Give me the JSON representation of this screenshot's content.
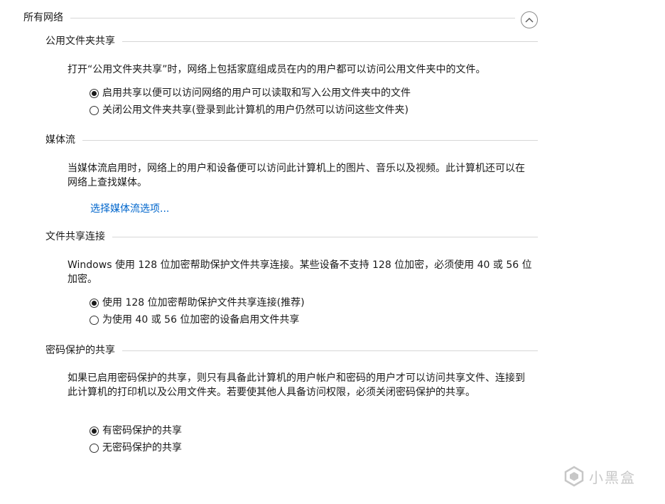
{
  "group": {
    "title": "所有网络"
  },
  "sections": [
    {
      "title": "公用文件夹共享",
      "desc": "打开“公用文件夹共享”时，网络上包括家庭组成员在内的用户都可以访问公用文件夹中的文件。",
      "options": [
        {
          "label": "启用共享以便可以访问网络的用户可以读取和写入公用文件夹中的文件",
          "checked": true
        },
        {
          "label": "关闭公用文件夹共享(登录到此计算机的用户仍然可以访问这些文件夹)",
          "checked": false
        }
      ]
    },
    {
      "title": "媒体流",
      "desc": "当媒体流启用时，网络上的用户和设备便可以访问此计算机上的图片、音乐以及视频。此计算机还可以在网络上查找媒体。",
      "link": "选择媒体流选项..."
    },
    {
      "title": "文件共享连接",
      "desc": "Windows 使用 128 位加密帮助保护文件共享连接。某些设备不支持 128 位加密，必须使用 40 或 56 位加密。",
      "options": [
        {
          "label": "使用 128 位加密帮助保护文件共享连接(推荐)",
          "checked": true
        },
        {
          "label": "为使用 40 或 56 位加密的设备启用文件共享",
          "checked": false
        }
      ]
    },
    {
      "title": "密码保护的共享",
      "desc": "如果已启用密码保护的共享，则只有具备此计算机的用户帐户和密码的用户才可以访问共享文件、连接到此计算机的打印机以及公用文件夹。若要使其他人具备访问权限，必须关闭密码保护的共享。",
      "options": [
        {
          "label": "有密码保护的共享",
          "checked": true
        },
        {
          "label": "无密码保护的共享",
          "checked": false
        }
      ]
    }
  ],
  "watermark": {
    "text": "小黑盒"
  },
  "colors": {
    "link": "#0066cc",
    "separator": "#d6d6d6"
  },
  "icons": {
    "collapse": "chevron-up-icon",
    "watermark": "heybox-logo-icon"
  }
}
